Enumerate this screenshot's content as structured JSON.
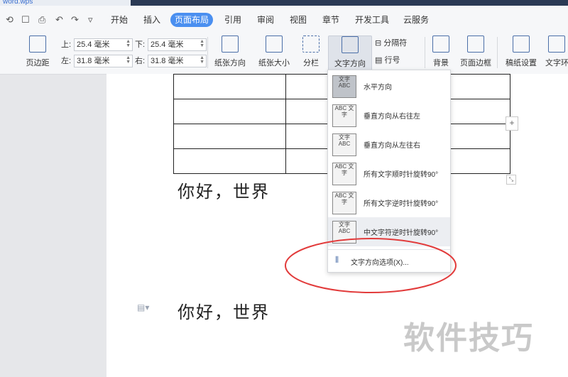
{
  "titlebar": {
    "doc_name": "word.wps"
  },
  "quick_access": [
    "⟲",
    "☐",
    "⎙",
    "↶",
    "↷",
    "▿"
  ],
  "menu": {
    "tabs": [
      "开始",
      "插入",
      "页面布局",
      "引用",
      "审阅",
      "视图",
      "章节",
      "开发工具",
      "云服务"
    ],
    "active_tab": "页面布局"
  },
  "ribbon": {
    "margins_label": "页边距",
    "top_label": "上:",
    "top_value": "25.4 毫米",
    "left_label": "左:",
    "left_value": "31.8 毫米",
    "bottom_label": "下:",
    "bottom_value": "25.4 毫米",
    "right_label": "右:",
    "right_value": "31.8 毫米",
    "orientation_label": "纸张方向",
    "size_label": "纸张大小",
    "columns_label": "分栏",
    "text_direction_label": "文字方向",
    "separator_label": "分隔符",
    "line_number_label": "行号",
    "background_label": "背景",
    "page_border_label": "页面边框",
    "manuscript_label": "稿纸设置",
    "text_wrap_label": "文字环"
  },
  "dropdown": {
    "options": [
      {
        "icon_text": "文字 ABC",
        "label": "水平方向"
      },
      {
        "icon_text": "ABC 文字",
        "label": "垂直方向从右往左"
      },
      {
        "icon_text": "文字 ABC",
        "label": "垂直方向从左往右"
      },
      {
        "icon_text": "ABC 文字",
        "label": "所有文字顺时针旋转90°"
      },
      {
        "icon_text": "ABC 文字",
        "label": "所有文字逆时针旋转90°"
      },
      {
        "icon_text": "文字 ABC",
        "label": "中文字符逆时针旋转90°"
      }
    ],
    "footer_label": "文字方向选项(X)..."
  },
  "document": {
    "line1": "你好，世界",
    "line2": "你好，世界"
  },
  "watermark": "软件技巧",
  "colors": {
    "accent": "#4a8ff0",
    "annotation": "#e23b3b"
  }
}
